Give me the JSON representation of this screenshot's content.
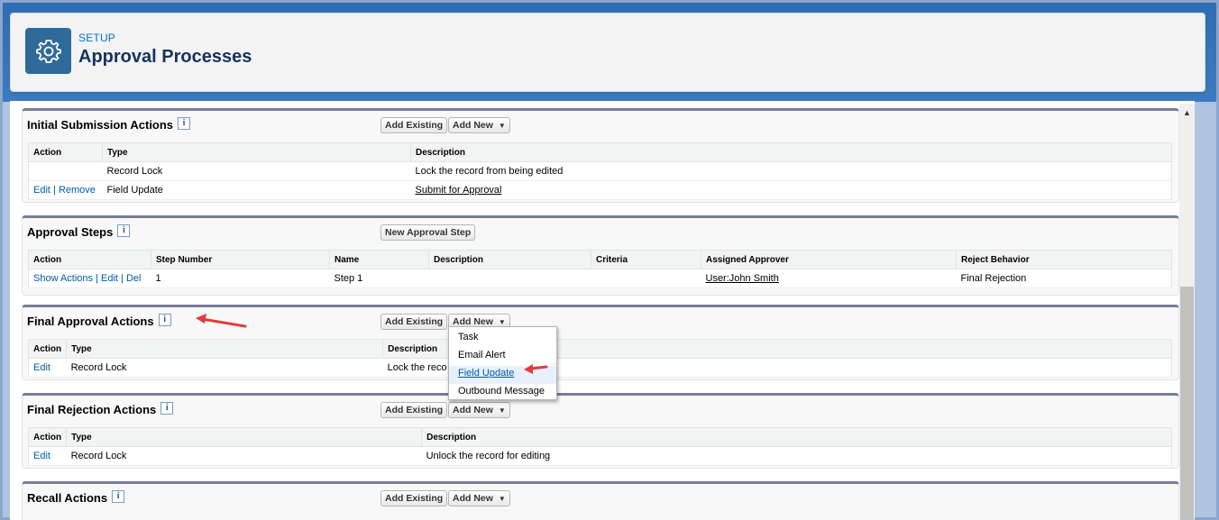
{
  "header": {
    "icon": "gear-icon",
    "breadcrumb": "SETUP",
    "title": "Approval Processes"
  },
  "sections": {
    "initial_submission": {
      "title": "Initial Submission Actions",
      "add_existing": "Add Existing",
      "add_new": "Add New",
      "columns": [
        "Action",
        "Type",
        "Description"
      ],
      "rows": [
        {
          "action_edit": "",
          "action_remove": "",
          "type": "Record Lock",
          "description": "Lock the record from being edited"
        },
        {
          "action_edit": "Edit",
          "action_sep": "|",
          "action_remove": "Remove",
          "type": "Field Update",
          "description": "Submit for Approval"
        }
      ]
    },
    "approval_steps": {
      "title": "Approval Steps",
      "new_step": "New Approval Step",
      "columns": [
        "Action",
        "Step Number",
        "Name",
        "Description",
        "Criteria",
        "Assigned Approver",
        "Reject Behavior"
      ],
      "row": {
        "show_actions": "Show Actions",
        "edit": "Edit",
        "del": "Del",
        "sep": "|",
        "step_number": "1",
        "name": "Step 1",
        "description": "",
        "criteria": "",
        "approver": "User:John Smith",
        "reject_behavior": "Final Rejection"
      }
    },
    "final_approval": {
      "title": "Final Approval Actions",
      "add_existing": "Add Existing",
      "add_new": "Add New",
      "columns": [
        "Action",
        "Type",
        "Description"
      ],
      "row": {
        "edit": "Edit",
        "type": "Record Lock",
        "description": "Lock the reco"
      }
    },
    "final_rejection": {
      "title": "Final Rejection Actions",
      "add_existing": "Add Existing",
      "add_new": "Add New",
      "columns": [
        "Action",
        "Type",
        "Description"
      ],
      "row": {
        "edit": "Edit",
        "type": "Record Lock",
        "description": "Unlock the record for editing"
      }
    },
    "recall": {
      "title": "Recall Actions",
      "add_existing": "Add Existing",
      "add_new": "Add New"
    }
  },
  "dropdown": {
    "items": [
      "Task",
      "Email Alert",
      "Field Update",
      "Outbound Message"
    ],
    "highlighted": "Field Update"
  },
  "info_glyph": "i",
  "caret_glyph": "▼",
  "colors": {
    "link": "#015ba7",
    "header_icon_bg": "#2e6b9a",
    "panel_border": "#747e96",
    "annotation_arrow": "#e03c3c"
  }
}
